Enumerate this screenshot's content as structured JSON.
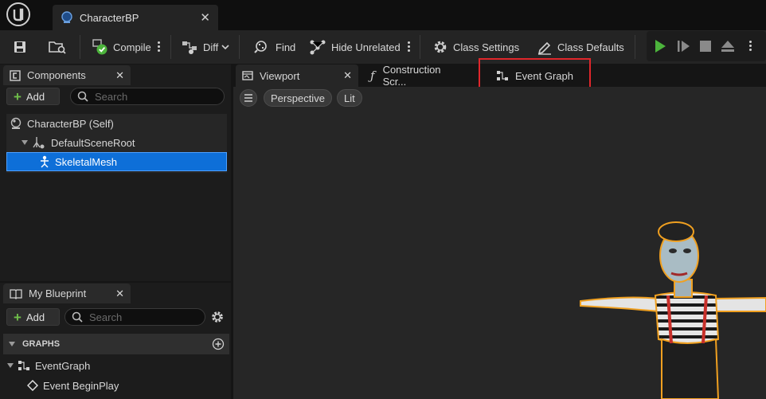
{
  "document_tab": {
    "title": "CharacterBP"
  },
  "toolbar": {
    "compile_label": "Compile",
    "diff_label": "Diff",
    "find_label": "Find",
    "hide_unrelated_label": "Hide Unrelated",
    "class_settings_label": "Class Settings",
    "class_defaults_label": "Class Defaults"
  },
  "components_panel": {
    "title": "Components",
    "add_label": "Add",
    "search_placeholder": "Search",
    "tree": [
      {
        "label": "CharacterBP (Self)"
      },
      {
        "label": "DefaultSceneRoot"
      },
      {
        "label": "SkeletalMesh",
        "selected": true
      }
    ]
  },
  "my_blueprint_panel": {
    "title": "My Blueprint",
    "add_label": "Add",
    "search_placeholder": "Search",
    "graphs_section": "GRAPHS",
    "graphs": [
      {
        "label": "EventGraph"
      },
      {
        "label": "Event BeginPlay"
      }
    ]
  },
  "editor_tabs": [
    {
      "label": "Viewport"
    },
    {
      "label": "Construction Scr..."
    },
    {
      "label": "Event Graph",
      "highlighted": true
    }
  ],
  "viewport": {
    "view_mode": "Perspective",
    "lighting_mode": "Lit"
  },
  "colors": {
    "accent_play": "#4cb43c",
    "selection_blue": "#0e6fd8",
    "highlight_red": "#e0262b",
    "compile_check": "#4cb43c"
  }
}
